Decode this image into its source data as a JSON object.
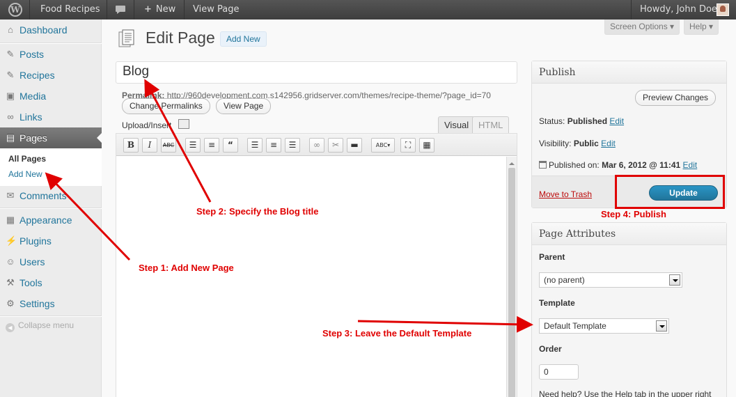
{
  "adminbar": {
    "site_name": "Food Recipes",
    "new_label": "New",
    "view_label": "View Page",
    "howdy": "Howdy, John Doe",
    "icons": [
      "wordpress-logo-icon",
      "comment-bubble-icon",
      "plus-icon",
      "avatar"
    ]
  },
  "sidebar": {
    "items": [
      {
        "label": "Dashboard",
        "icon": "house-icon"
      },
      {
        "label": "Posts",
        "icon": "pin-icon"
      },
      {
        "label": "Recipes",
        "icon": "pin-icon"
      },
      {
        "label": "Media",
        "icon": "media-icon"
      },
      {
        "label": "Links",
        "icon": "link-icon"
      },
      {
        "label": "Pages",
        "icon": "page-icon"
      },
      {
        "label": "Comments",
        "icon": "comment-icon"
      },
      {
        "label": "Appearance",
        "icon": "appearance-icon"
      },
      {
        "label": "Plugins",
        "icon": "plugin-icon"
      },
      {
        "label": "Users",
        "icon": "users-icon"
      },
      {
        "label": "Tools",
        "icon": "tools-icon"
      },
      {
        "label": "Settings",
        "icon": "settings-icon"
      }
    ],
    "submenu": {
      "all_pages": "All Pages",
      "add_new": "Add New"
    },
    "collapse": "Collapse menu"
  },
  "screen_options": "Screen Options",
  "help": "Help",
  "heading": {
    "title": "Edit Page",
    "add_new": "Add New"
  },
  "editor": {
    "title_value": "Blog",
    "permalink_label": "Permalink:",
    "permalink_url": "http://960development.com.s142956.gridserver.com/themes/recipe-theme/?page_id=70",
    "change_permalinks": "Change Permalinks",
    "view_page": "View Page",
    "upload_insert": "Upload/Insert",
    "tab_visual": "Visual",
    "tab_html": "HTML",
    "toolbar": [
      "B",
      "I",
      "ABC",
      "bullet-list-icon",
      "number-list-icon",
      "quote-icon",
      "align-left-icon",
      "align-center-icon",
      "align-right-icon",
      "link-icon",
      "unlink-icon",
      "more-tag-icon",
      "spellcheck-icon",
      "fullscreen-icon",
      "kitchen-sink-icon"
    ]
  },
  "publish": {
    "title": "Publish",
    "preview": "Preview Changes",
    "status_label": "Status:",
    "status_value": "Published",
    "visibility_label": "Visibility:",
    "visibility_value": "Public",
    "published_label": "Published on:",
    "published_value": "Mar 6, 2012 @ 11:41",
    "edit": "Edit",
    "trash": "Move to Trash",
    "update": "Update"
  },
  "attributes": {
    "title": "Page Attributes",
    "parent_label": "Parent",
    "parent_value": "(no parent)",
    "template_label": "Template",
    "template_value": "Default Template",
    "order_label": "Order",
    "order_value": "0",
    "help_text": "Need help? Use the Help tab in the upper right"
  },
  "annotations": {
    "step1": "Step 1: Add New Page",
    "step2": "Step 2: Specify the Blog title",
    "step3": "Step 3: Leave the Default Template",
    "step4": "Step 4: Publish",
    "color": "#e00000"
  },
  "colors": {
    "link": "#21759b",
    "update_button": "#21759b",
    "trash": "#bc0b0b"
  }
}
